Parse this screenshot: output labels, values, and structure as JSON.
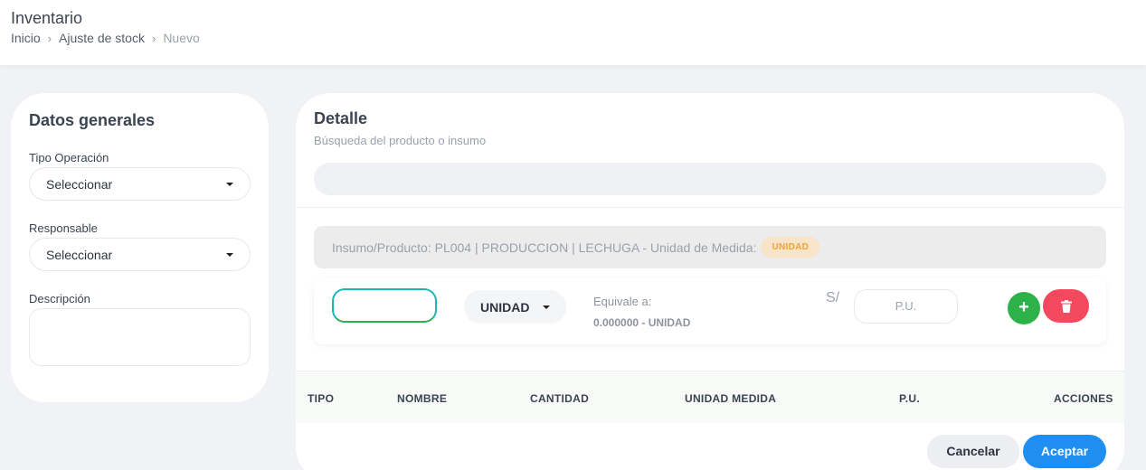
{
  "header": {
    "title": "Inventario",
    "breadcrumb": [
      "Inicio",
      "Ajuste de stock",
      "Nuevo"
    ]
  },
  "general": {
    "title": "Datos generales",
    "tipo_operacion": {
      "label": "Tipo Operación",
      "value": "Seleccionar"
    },
    "responsable": {
      "label": "Responsable",
      "value": "Seleccionar"
    },
    "descripcion": {
      "label": "Descripción",
      "value": ""
    }
  },
  "detail": {
    "title": "Detalle",
    "subtitle": "Búsqueda del producto o insumo",
    "search_value": "",
    "product_info": "Insumo/Producto: PL004 | PRODUCCION | LECHUGA - Unidad de Medida:",
    "unit_badge": "UNIDAD",
    "line": {
      "quantity": "",
      "unit": "UNIDAD",
      "equiv_label": "Equivale a:",
      "equiv_value": "0.000000 - UNIDAD",
      "currency": "S/",
      "pu_placeholder": "P.U.",
      "add_symbol": "+"
    },
    "table_headers": [
      "TIPO",
      "NOMBRE",
      "CANTIDAD",
      "UNIDAD MEDIDA",
      "P.U.",
      "ACCIONES"
    ],
    "cancel_label": "Cancelar",
    "accept_label": "Aceptar"
  },
  "colors": {
    "accent": "#1e8ef2",
    "add": "#2db24a",
    "delete": "#f2495f",
    "badge_bg": "#f7e4c9",
    "badge_text": "#f0a23a"
  },
  "icons": [
    "chevron-right-icon",
    "caret-down-icon",
    "plus-icon",
    "trash-icon"
  ]
}
